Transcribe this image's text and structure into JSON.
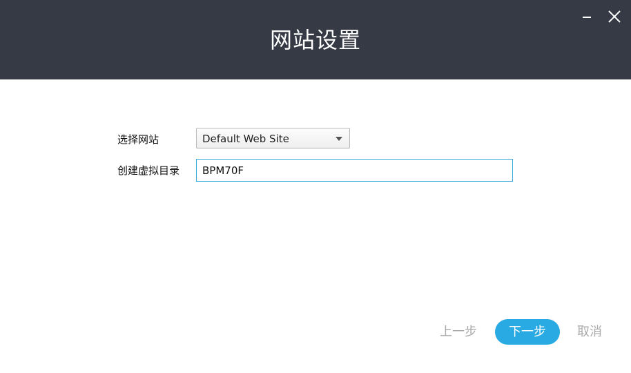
{
  "window": {
    "title": "网站设置",
    "minimize_icon": "minimize-icon",
    "close_icon": "close-icon"
  },
  "form": {
    "site_label": "选择网站",
    "site_value": "Default Web Site",
    "vdir_label": "创建虚拟目录",
    "vdir_value": "BPM70F"
  },
  "footer": {
    "prev_label": "上一步",
    "next_label": "下一步",
    "cancel_label": "取消"
  },
  "colors": {
    "titlebar": "#353a45",
    "accent": "#29aae2",
    "disabled_text": "#a9a9a9"
  }
}
